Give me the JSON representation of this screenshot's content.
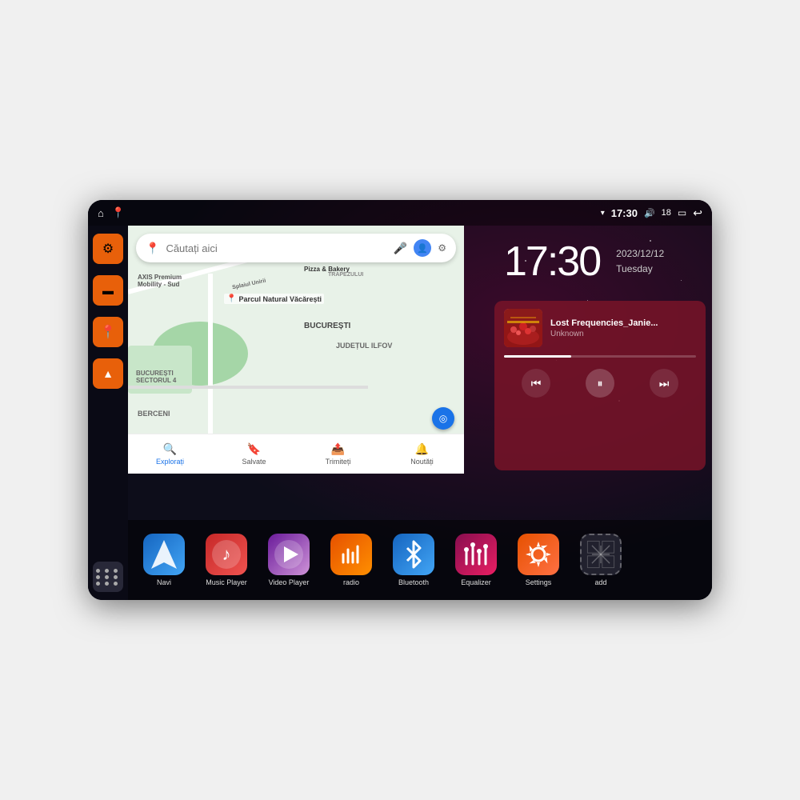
{
  "device": {
    "status_bar": {
      "wifi_icon": "▼",
      "time": "17:30",
      "volume_icon": "🔊",
      "battery_level": "18",
      "battery_icon": "🔋",
      "back_icon": "↩"
    },
    "sidebar": {
      "items": [
        {
          "id": "settings",
          "icon": "⚙",
          "color": "orange"
        },
        {
          "id": "files",
          "icon": "📁",
          "color": "orange"
        },
        {
          "id": "maps",
          "icon": "📍",
          "color": "orange"
        },
        {
          "id": "navigation",
          "icon": "▲",
          "color": "orange"
        },
        {
          "id": "grid",
          "icon": "grid",
          "color": "dark"
        }
      ]
    },
    "map": {
      "search_placeholder": "Căutați aici",
      "tabs": [
        {
          "label": "Explorați",
          "icon": "🔍",
          "active": true
        },
        {
          "label": "Salvate",
          "icon": "🔖",
          "active": false
        },
        {
          "label": "Trimiteți",
          "icon": "📤",
          "active": false
        },
        {
          "label": "Noutăți",
          "icon": "🔔",
          "active": false
        }
      ],
      "poi_labels": [
        "AXIS Premium Mobility - Sud",
        "Pizza & Bakery",
        "Parcul Natural Văcărești",
        "TRAPEZULUI",
        "BUCUREȘTI",
        "JUDEȚUL ILFOV",
        "BUCUREȘTI SECTORUL 4",
        "BERCENI"
      ]
    },
    "clock": {
      "time": "17:30",
      "date": "2023/12/12",
      "day": "Tuesday"
    },
    "music": {
      "title": "Lost Frequencies_Janie...",
      "artist": "Unknown",
      "album_art_emoji": "🎵",
      "controls": {
        "prev": "⏮",
        "play": "⏸",
        "next": "⏭"
      }
    },
    "apps": [
      {
        "id": "navi",
        "label": "Navi",
        "icon": "navi",
        "color_class": "ic-navi"
      },
      {
        "id": "music-player",
        "label": "Music Player",
        "icon": "music",
        "color_class": "ic-music"
      },
      {
        "id": "video-player",
        "label": "Video Player",
        "icon": "video",
        "color_class": "ic-video"
      },
      {
        "id": "radio",
        "label": "radio",
        "icon": "radio",
        "color_class": "ic-radio"
      },
      {
        "id": "bluetooth",
        "label": "Bluetooth",
        "icon": "bluetooth",
        "color_class": "ic-bt"
      },
      {
        "id": "equalizer",
        "label": "Equalizer",
        "icon": "equalizer",
        "color_class": "ic-eq"
      },
      {
        "id": "settings",
        "label": "Settings",
        "icon": "settings",
        "color_class": "ic-settings"
      },
      {
        "id": "add",
        "label": "add",
        "icon": "add",
        "color_class": "ic-add"
      }
    ]
  }
}
